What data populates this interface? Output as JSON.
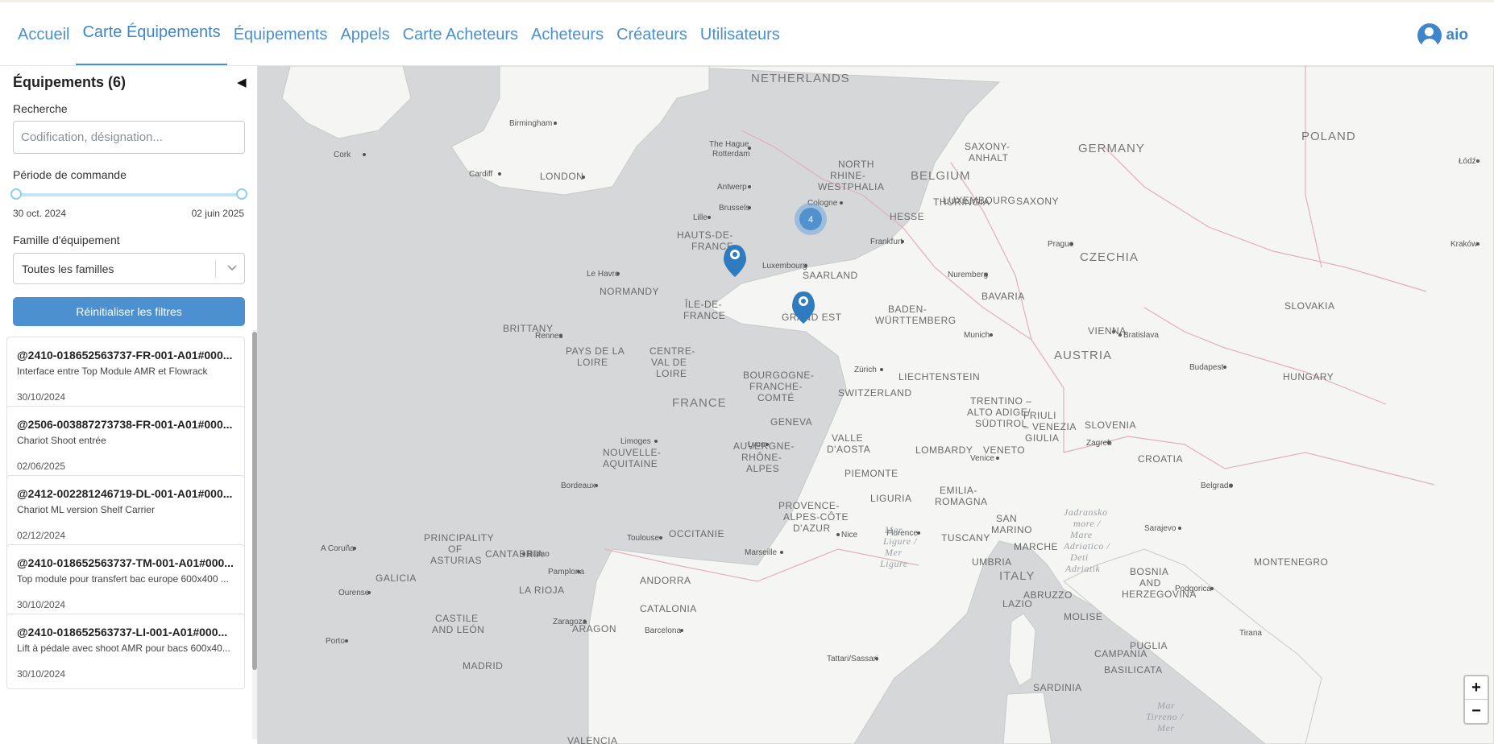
{
  "nav": {
    "items": [
      {
        "label": "Accueil"
      },
      {
        "label": "Carte Équipements"
      },
      {
        "label": "Équipements"
      },
      {
        "label": "Appels"
      },
      {
        "label": "Carte Acheteurs"
      },
      {
        "label": "Acheteurs"
      },
      {
        "label": "Créateurs"
      },
      {
        "label": "Utilisateurs"
      }
    ],
    "active": "Carte Équipements",
    "user": "aio"
  },
  "sidebar": {
    "title": "Équipements (6)",
    "collapse_glyph": "◀",
    "search_label": "Recherche",
    "search_placeholder": "Codification, désignation...",
    "period_label": "Période de commande",
    "period_start": "30 oct. 2024",
    "period_end": "02 juin 2025",
    "family_label": "Famille d'équipement",
    "family_value": "Toutes les familles",
    "reset_label": "Réinitialiser les filtres",
    "items": [
      {
        "code": "@2410-018652563737-FR-001-A01#000...",
        "desc": "Interface entre Top Module AMR et Flowrack",
        "date": "30/10/2024"
      },
      {
        "code": "@2506-003887273738-FR-001-A01#000...",
        "desc": "Chariot Shoot entrée",
        "date": "02/06/2025"
      },
      {
        "code": "@2412-002281246719-DL-001-A01#000...",
        "desc": "Chariot ML version Shelf Carrier",
        "date": "02/12/2024"
      },
      {
        "code": "@2410-018652563737-TM-001-A01#000...",
        "desc": "Top module pour transfert bac europe 600x400 ...",
        "date": "30/10/2024"
      },
      {
        "code": "@2410-018652563737-LI-001-A01#000...",
        "desc": "Lift à pédale avec shoot AMR pour bacs 600x40...",
        "date": "30/10/2024"
      }
    ]
  },
  "map": {
    "cluster_count": "4",
    "zoom_in": "+",
    "zoom_out": "−",
    "labels": {
      "countries": [
        "NETHERLANDS",
        "GERMANY",
        "BELGIUM",
        "LUXEMBOURG",
        "FRANCE",
        "SWITZERLAND",
        "LIECHTENSTEIN",
        "AUSTRIA",
        "CZECHIA",
        "SLOVAKIA",
        "HUNGARY",
        "POLAND",
        "SLOVENIA",
        "CROATIA",
        "ITALY",
        "ANDORRA",
        "SAN MARINO",
        "MONTENEGRO",
        "BOSNIA AND HERZEGOVINA"
      ],
      "regions": [
        "NORTH RHINE-WESTPHALIA",
        "SAXONY-ANHALT",
        "HESSE",
        "THURINGIA",
        "SAXONY",
        "SAARLAND",
        "BAVARIA",
        "BADEN-WÜRTTEMBERG",
        "GRAND EST",
        "HAUTS-DE-FRANCE",
        "NORMANDY",
        "ÎLE-DE-FRANCE",
        "BRITTANY",
        "PAYS DE LA LOIRE",
        "CENTRE-VAL DE LOIRE",
        "BOURGOGNE-FRANCHE-COMTÉ",
        "NOUVELLE-AQUITAINE",
        "AUVERGNE-RHÔNE-ALPES",
        "OCCITANIE",
        "PROVENCE-ALPES-CÔTE D'AZUR",
        "VALLE D'AOSTA",
        "PIEMONTE",
        "LOMBARDY",
        "TRENTINO – ALTO ADIGE/ SÜDTIROL",
        "FRIULI – VENEZIA GIULIA",
        "VENETO",
        "LIGURIA",
        "EMILIA-ROMAGNA",
        "TUSCANY",
        "UMBRIA",
        "MARCHE",
        "LAZIO",
        "ABRUZZO",
        "MOLISE",
        "CAMPANIA",
        "PUGLIA",
        "BASILICATA",
        "SARDINIA",
        "PRINCIPALITY OF ASTURIAS",
        "CANTABRIA",
        "GALICIA",
        "LA RIOJA",
        "CASTILE AND LEÓN",
        "ARAGON",
        "CATALONIA",
        "MADRID",
        "VALENCIA",
        "GENEVA"
      ],
      "cities": [
        "Birmingham",
        "Cork",
        "Cardiff",
        "LONDON",
        "The Hague",
        "Rotterdam",
        "Antwerp",
        "Brussels",
        "Cologne",
        "Lille",
        "Frankfurt",
        "Luxembourg",
        "Nuremberg",
        "Prague",
        "Kraków",
        "Łódź",
        "Le Havre",
        "Rennes",
        "Munich",
        "Vienna",
        "Bratislava",
        "Budapest",
        "Zürich",
        "Limoges",
        "Lyon",
        "Zagreb",
        "Venice",
        "Bordeaux",
        "Belgrade",
        "Toulouse",
        "Marseille",
        "Nice",
        "Florence",
        "Sarajevo",
        "A Coruña",
        "Bilbao",
        "Ourense",
        "Pamplona",
        "Zaragoza",
        "Barcelona",
        "Porto",
        "Tattari/Sassari",
        "Podgorica",
        "Tirana"
      ],
      "seas": [
        "Mar Ligure / Mer Ligure",
        "Jadransko more / Mare Adriatico / Deti Adriatik",
        "Mar Tirreno / Mer"
      ]
    }
  }
}
